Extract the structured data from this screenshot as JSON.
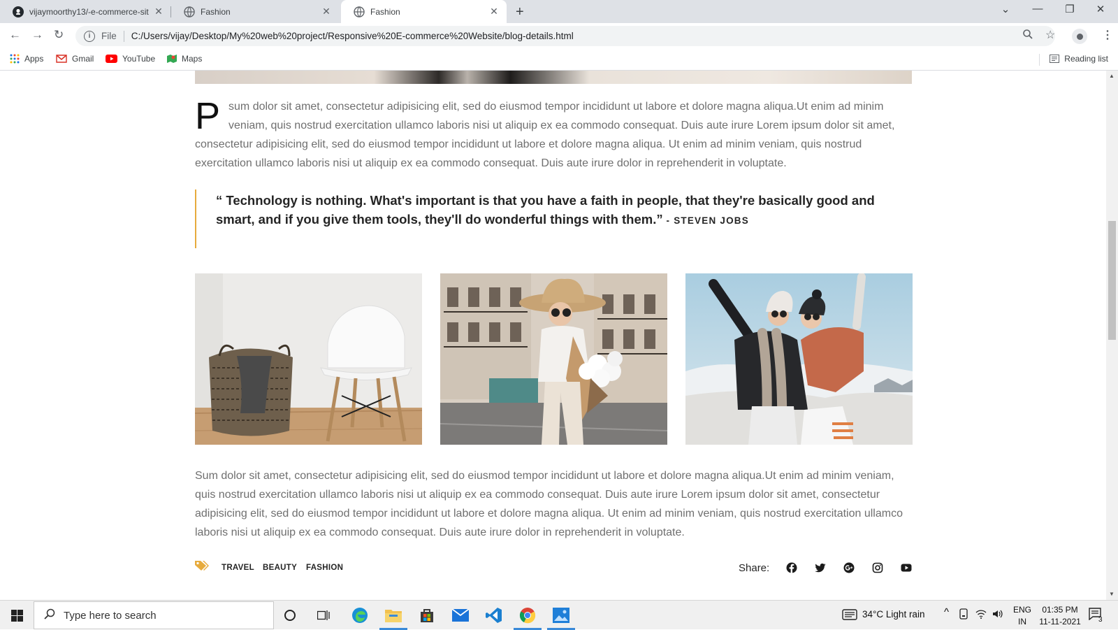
{
  "browser": {
    "tabs": [
      {
        "title": "vijaymoorthy13/-e-commerce-sit",
        "icon": "github-icon"
      },
      {
        "title": "Fashion",
        "icon": "globe-icon"
      },
      {
        "title": "Fashion",
        "icon": "globe-icon",
        "active": true
      }
    ],
    "close_glyph": "✕",
    "new_tab_glyph": "+",
    "url_scheme": "File",
    "url": "C:/Users/vijay/Desktop/My%20web%20project/Responsive%20E-commerce%20Website/blog-details.html",
    "bookmarks": [
      {
        "label": "Apps",
        "icon": "apps-grid-icon"
      },
      {
        "label": "Gmail",
        "icon": "gmail-icon"
      },
      {
        "label": "YouTube",
        "icon": "youtube-icon"
      },
      {
        "label": "Maps",
        "icon": "maps-icon"
      }
    ],
    "reading_list": "Reading list"
  },
  "article": {
    "dropcap": "P",
    "para1": "sum dolor sit amet, consectetur adipisicing elit, sed do eiusmod tempor incididunt ut labore et dolore magna aliqua.Ut enim ad minim veniam, quis nostrud exercitation ullamco laboris nisi ut aliquip ex ea commodo consequat. Duis aute irure Lorem ipsum dolor sit amet, consectetur adipisicing elit, sed do eiusmod tempor incididunt ut labore et dolore magna aliqua. Ut enim ad minim veniam, quis nostrud exercitation ullamco laboris nisi ut aliquip ex ea commodo consequat. Duis aute irure dolor in reprehenderit in voluptate.",
    "quote": "“ Technology is nothing. What's important is that you have a faith in people, that they're basically good and smart, and if you give them tools, they'll do wonderful things with them.”",
    "quote_author": " - STEVEN JOBS",
    "para2": "Sum dolor sit amet, consectetur adipisicing elit, sed do eiusmod tempor incididunt ut labore et dolore magna aliqua.Ut enim ad minim veniam, quis nostrud exercitation ullamco laboris nisi ut aliquip ex ea commodo consequat. Duis aute irure Lorem ipsum dolor sit amet, consectetur adipisicing elit, sed do eiusmod tempor incididunt ut labore et dolore magna aliqua. Ut enim ad minim veniam, quis nostrud exercitation ullamco laboris nisi ut aliquip ex ea commodo consequat. Duis aute irure dolor in reprehenderit in voluptate.",
    "tags": [
      "TRAVEL",
      "BEAUTY",
      "FASHION"
    ],
    "share_label": "Share:",
    "share_icons": [
      "facebook-icon",
      "twitter-icon",
      "google-plus-icon",
      "instagram-icon",
      "youtube-icon"
    ],
    "accent_color": "#e7ab3c"
  },
  "taskbar": {
    "search_placeholder": "Type here to search",
    "weather": "34°C  Light rain",
    "lang_top": "ENG",
    "lang_bottom": "IN",
    "time": "01:35 PM",
    "date": "11-11-2021",
    "notification_count": "3"
  }
}
